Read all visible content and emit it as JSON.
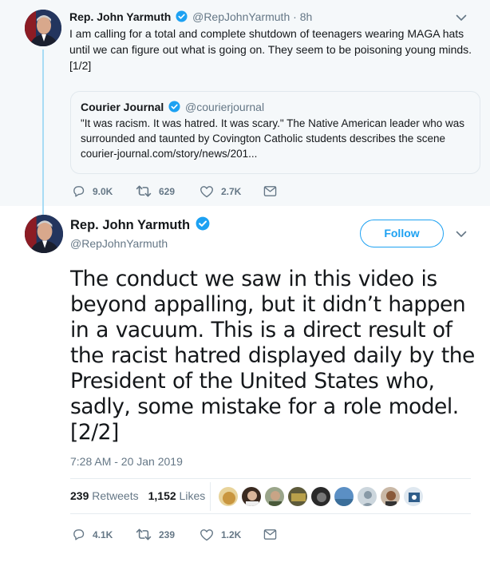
{
  "parent_tweet": {
    "author_name": "Rep. John Yarmuth",
    "handle": "@RepJohnYarmuth",
    "separator": "·",
    "time": "8h",
    "text": "I am calling for a total and complete shutdown of teenagers wearing MAGA hats until we can figure out what is going on. They seem to be poisoning young minds. [1/2]",
    "quoted_tweet": {
      "author_name": "Courier Journal",
      "handle": "@courierjournal",
      "text": "\"It was racism. It was hatred. It was scary.\" The Native American leader who was surrounded and taunted by Covington Catholic students describes the scene courier-journal.com/story/news/201..."
    },
    "actions": {
      "replies": "9.0K",
      "retweets": "629",
      "likes": "2.7K"
    }
  },
  "main_tweet": {
    "author_name": "Rep. John Yarmuth",
    "handle": "@RepJohnYarmuth",
    "follow_label": "Follow",
    "text": "The conduct we saw in this video is beyond appalling, but it didn’t happen in a vacuum. This is a direct result of the racist hatred displayed daily by the President of the United States who, sadly, some mistake for a role model. [2/2]",
    "timestamp": "7:28 AM - 20 Jan 2019",
    "stats": {
      "retweets_count": "239",
      "retweets_label": "Retweets",
      "likes_count": "1,152",
      "likes_label": "Likes"
    },
    "actions": {
      "replies": "4.1K",
      "retweets": "239",
      "likes": "1.2K"
    }
  },
  "icons": {
    "verified": "verified-badge-icon",
    "caret": "chevron-down-icon",
    "reply": "reply-icon",
    "retweet": "retweet-icon",
    "like": "heart-icon",
    "message": "direct-message-icon"
  },
  "colors": {
    "accent": "#1da1f2",
    "secondary_text": "#657786",
    "thread_line": "#a8dcf5",
    "context_background": "#f5f8fa"
  }
}
